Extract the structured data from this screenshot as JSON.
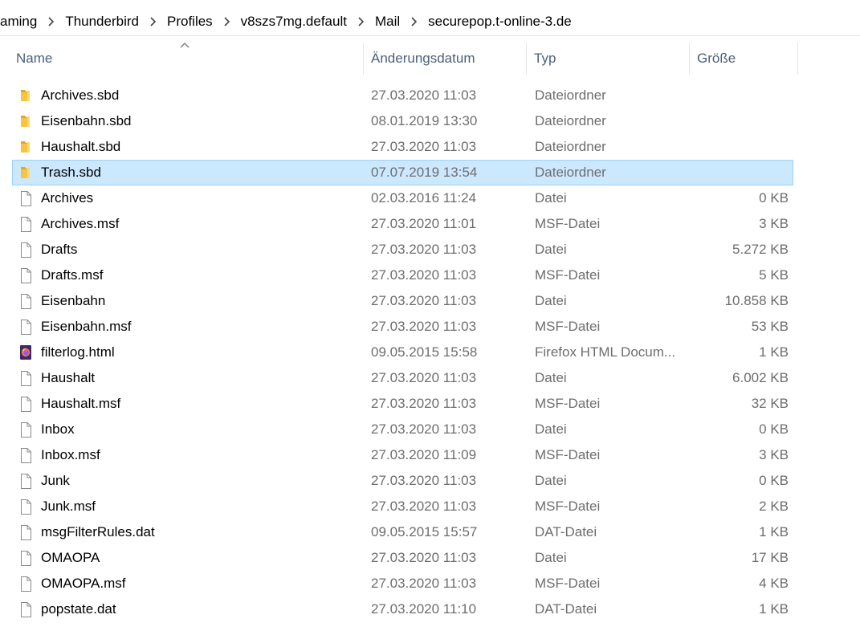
{
  "breadcrumb": [
    "aming",
    "Thunderbird",
    "Profiles",
    "v8szs7mg.default",
    "Mail",
    "securepop.t-online-3.de"
  ],
  "columns": {
    "name": "Name",
    "date": "Änderungsdatum",
    "type": "Typ",
    "size": "Größe"
  },
  "files": [
    {
      "name": "Archives.sbd",
      "date": "27.03.2020 11:03",
      "type": "Dateiordner",
      "size": "",
      "icon": "folder-icon"
    },
    {
      "name": "Eisenbahn.sbd",
      "date": "08.01.2019 13:30",
      "type": "Dateiordner",
      "size": "",
      "icon": "folder-icon"
    },
    {
      "name": "Haushalt.sbd",
      "date": "27.03.2020 11:03",
      "type": "Dateiordner",
      "size": "",
      "icon": "folder-icon"
    },
    {
      "name": "Trash.sbd",
      "date": "07.07.2019 13:54",
      "type": "Dateiordner",
      "size": "",
      "icon": "folder-icon",
      "selected": true
    },
    {
      "name": "Archives",
      "date": "02.03.2016 11:24",
      "type": "Datei",
      "size": "0 KB",
      "icon": "file-icon"
    },
    {
      "name": "Archives.msf",
      "date": "27.03.2020 11:01",
      "type": "MSF-Datei",
      "size": "3 KB",
      "icon": "file-icon"
    },
    {
      "name": "Drafts",
      "date": "27.03.2020 11:03",
      "type": "Datei",
      "size": "5.272 KB",
      "icon": "file-icon"
    },
    {
      "name": "Drafts.msf",
      "date": "27.03.2020 11:03",
      "type": "MSF-Datei",
      "size": "5 KB",
      "icon": "file-icon"
    },
    {
      "name": "Eisenbahn",
      "date": "27.03.2020 11:03",
      "type": "Datei",
      "size": "10.858 KB",
      "icon": "file-icon"
    },
    {
      "name": "Eisenbahn.msf",
      "date": "27.03.2020 11:03",
      "type": "MSF-Datei",
      "size": "53 KB",
      "icon": "file-icon"
    },
    {
      "name": "filterlog.html",
      "date": "09.05.2015 15:58",
      "type": "Firefox HTML Docum...",
      "size": "1 KB",
      "icon": "firefox-icon"
    },
    {
      "name": "Haushalt",
      "date": "27.03.2020 11:03",
      "type": "Datei",
      "size": "6.002 KB",
      "icon": "file-icon"
    },
    {
      "name": "Haushalt.msf",
      "date": "27.03.2020 11:03",
      "type": "MSF-Datei",
      "size": "32 KB",
      "icon": "file-icon"
    },
    {
      "name": "Inbox",
      "date": "27.03.2020 11:03",
      "type": "Datei",
      "size": "0 KB",
      "icon": "file-icon"
    },
    {
      "name": "Inbox.msf",
      "date": "27.03.2020 11:09",
      "type": "MSF-Datei",
      "size": "3 KB",
      "icon": "file-icon"
    },
    {
      "name": "Junk",
      "date": "27.03.2020 11:03",
      "type": "Datei",
      "size": "0 KB",
      "icon": "file-icon"
    },
    {
      "name": "Junk.msf",
      "date": "27.03.2020 11:03",
      "type": "MSF-Datei",
      "size": "2 KB",
      "icon": "file-icon"
    },
    {
      "name": "msgFilterRules.dat",
      "date": "09.05.2015 15:57",
      "type": "DAT-Datei",
      "size": "1 KB",
      "icon": "file-icon"
    },
    {
      "name": "OMAOPA",
      "date": "27.03.2020 11:03",
      "type": "Datei",
      "size": "17 KB",
      "icon": "file-icon"
    },
    {
      "name": "OMAOPA.msf",
      "date": "27.03.2020 11:03",
      "type": "MSF-Datei",
      "size": "4 KB",
      "icon": "file-icon"
    },
    {
      "name": "popstate.dat",
      "date": "27.03.2020 11:10",
      "type": "DAT-Datei",
      "size": "1 KB",
      "icon": "file-icon"
    }
  ],
  "colors": {
    "selection_bg": "#cce8ff",
    "selection_border": "#99d1ff",
    "header_text": "#4a607a",
    "folder": "#f5c542"
  }
}
